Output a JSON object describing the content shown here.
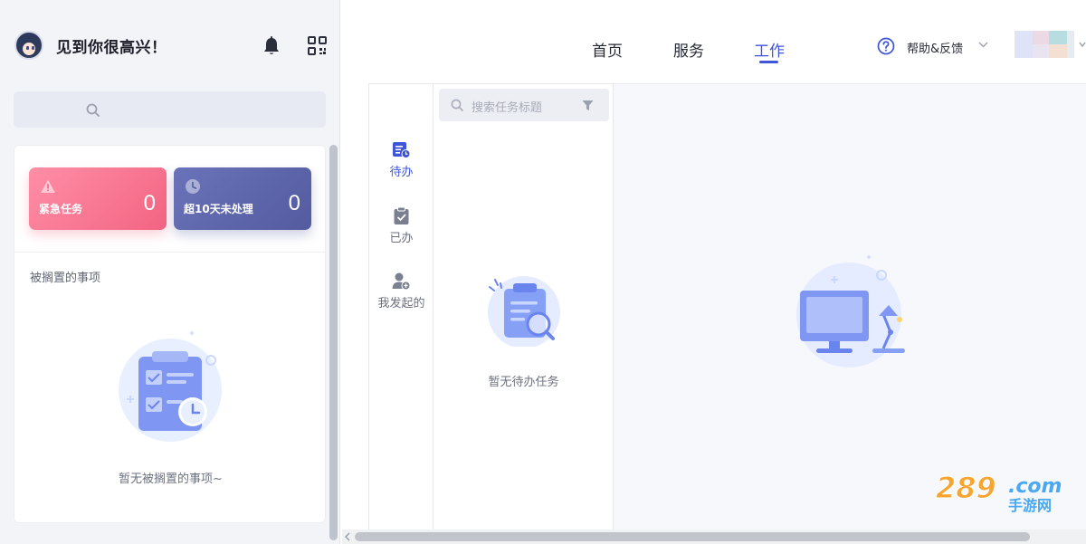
{
  "left_panel": {
    "greeting": "见到你很高兴！",
    "stats": [
      {
        "label": "紧急任务",
        "count": "0",
        "icon": "warning-icon",
        "color": "#f26482"
      },
      {
        "label": "超10天未处理",
        "count": "0",
        "icon": "clock-icon",
        "color": "#545b9f"
      }
    ],
    "shelved_title": "被搁置的事项",
    "shelved_empty": "暂无被搁置的事项~"
  },
  "top_nav": {
    "items": [
      "首页",
      "服务",
      "工作"
    ],
    "active": "工作",
    "help_label": "帮助&反馈"
  },
  "work": {
    "side_nav": [
      {
        "label": "待办",
        "icon": "todo-list-icon",
        "active": true
      },
      {
        "label": "已办",
        "icon": "done-clipboard-icon",
        "active": false
      },
      {
        "label": "我发起的",
        "icon": "user-add-icon",
        "active": false
      }
    ],
    "search_placeholder": "搜索任务标题",
    "todo_empty": "暂无待办任务"
  },
  "colors": {
    "accent": "#3f55d9",
    "urgent": "#f26482",
    "overdue": "#545b9f"
  }
}
